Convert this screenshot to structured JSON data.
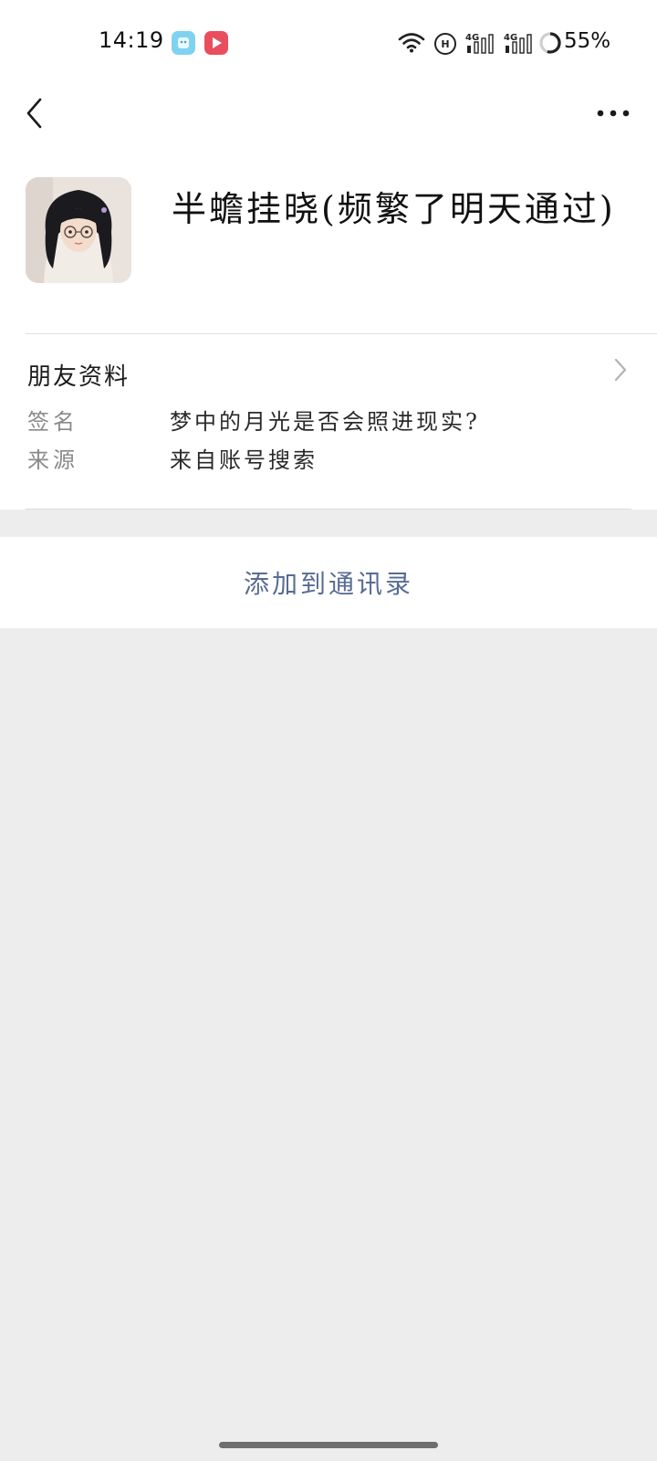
{
  "status_bar": {
    "time": "14:19",
    "battery_percent": "55%",
    "network_1": "4G",
    "network_2": "4G",
    "hd_label": "H"
  },
  "nav": {
    "back_icon": "chevron-left-icon",
    "more_icon": "more-dots-icon"
  },
  "profile": {
    "name": "半蟾挂晓(频繁了明天通过)"
  },
  "info": {
    "section_title": "朋友资料",
    "rows": [
      {
        "label": "签名",
        "value": "梦中的月光是否会照进现实?"
      },
      {
        "label": "来源",
        "value": "来自账号搜索"
      }
    ]
  },
  "actions": {
    "add_contact_label": "添加到通讯录"
  },
  "colors": {
    "link": "#576b95",
    "background": "#ededed",
    "surface": "#ffffff"
  }
}
